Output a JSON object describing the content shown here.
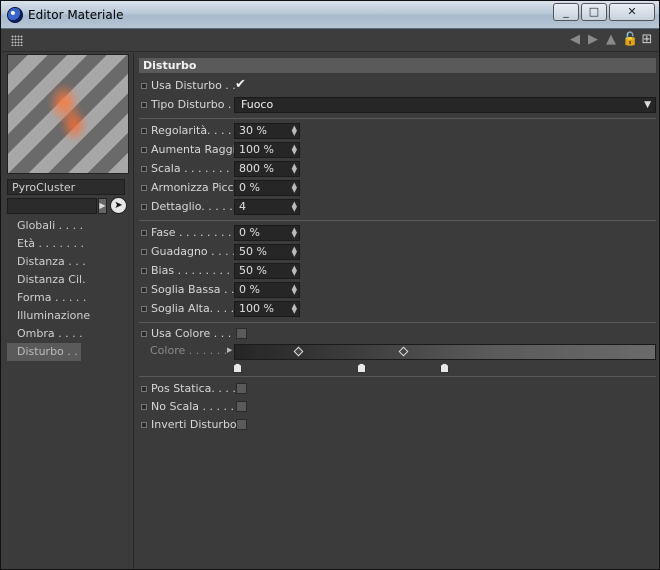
{
  "window": {
    "title": "Editor Materiale",
    "buttons": [
      "_",
      "□",
      "✕"
    ]
  },
  "material": {
    "name": "PyroCluster",
    "search_value": ""
  },
  "nav": {
    "items": [
      {
        "label": "Globali . . . ."
      },
      {
        "label": "Età . . . . . . ."
      },
      {
        "label": "Distanza . . ."
      },
      {
        "label": "Distanza Cil."
      },
      {
        "label": "Forma . . . . ."
      },
      {
        "label": "Illuminazione"
      },
      {
        "label": "Ombra . . . ."
      },
      {
        "label": "Disturbo . . ."
      }
    ],
    "active_index": 7
  },
  "section": {
    "title": "Disturbo"
  },
  "params": {
    "usa_disturbo": {
      "label": "Usa Disturbo . .",
      "checked": true
    },
    "tipo_disturbo": {
      "label": "Tipo Disturbo . .",
      "value": "Fuoco"
    },
    "regolarita": {
      "label": "Regolarità. . . . .",
      "value": "30 %"
    },
    "aumenta_raggio": {
      "label": "Aumenta Raggio",
      "value": "100 %"
    },
    "scala": {
      "label": "Scala . . . . . . . .",
      "value": "800 %"
    },
    "armonizza_picco": {
      "label": "Armonizza Picco",
      "value": "0 %"
    },
    "dettaglio": {
      "label": "Dettaglio. . . . . .",
      "value": "4"
    },
    "fase": {
      "label": "Fase . . . . . . . . .",
      "value": "0 %"
    },
    "guadagno": {
      "label": "Guadagno . . . . .",
      "value": "50 %"
    },
    "bias": {
      "label": "Bias . . . . . . . . .",
      "value": "50 %"
    },
    "soglia_bassa": {
      "label": "Soglia Bassa . .",
      "value": "0 %"
    },
    "soglia_alta": {
      "label": "Soglia  Alta. . . .",
      "value": "100 %"
    },
    "usa_colore": {
      "label": "Usa Colore . . . .",
      "checked": false
    },
    "colore": {
      "label": "Colore . . . . . ."
    },
    "pos_statica": {
      "label": "Pos Statica. . . .",
      "checked": false
    },
    "no_scala": {
      "label": "No Scala . . . . .",
      "checked": false
    },
    "inverti_disturbo": {
      "label": "Inverti Disturbo",
      "checked": false
    }
  }
}
